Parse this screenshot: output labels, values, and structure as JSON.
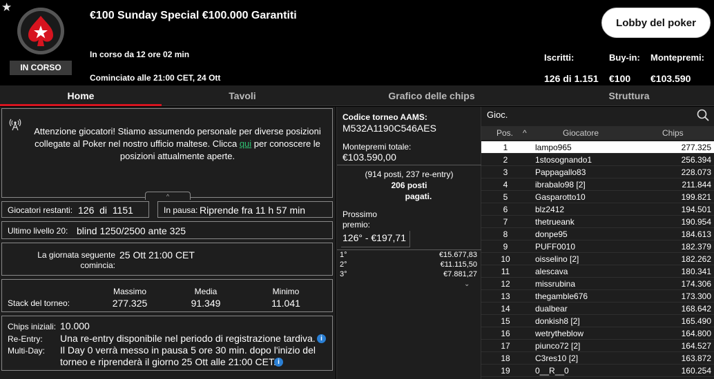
{
  "header": {
    "favorite_icon": "star-icon",
    "status": "IN CORSO",
    "title": "€100 Sunday Special €100.000 Garantiti",
    "running": "In corso da 12 ore 02 min",
    "started": "Cominciato alle 21:00 CET, 24 Ott",
    "lobby_button": "Lobby del poker",
    "registered_label": "Iscritti:",
    "registered_value": "126 di 1.151",
    "buyin_label": "Buy-in:",
    "buyin_value": "€100",
    "prize_label": "Montepremi:",
    "prize_value": "€103.590",
    "brand_color": "#d7141f"
  },
  "tabs": [
    {
      "label": "Home"
    },
    {
      "label": "Tavoli"
    },
    {
      "label": "Grafico delle chips"
    },
    {
      "label": "Struttura"
    }
  ],
  "announcement": {
    "text_before": "Attenzione giocatori! Stiamo assumendo personale per diverse posizioni collegate al Poker nel nostro ufficio maltese. Clicca ",
    "link": "qui",
    "text_after": " per conoscere le posizioni attualmente aperte."
  },
  "info": {
    "remaining_label": "Giocatori restanti:",
    "remaining_value": "126  di  1151",
    "pause_label": "In pausa:",
    "pause_value": "Riprende fra 11 h 57 min",
    "last_level_label": "Ultimo livello 20:",
    "last_level_value": "blind 1250/2500 ante 325",
    "next_day_label_1": "La giornata seguente",
    "next_day_label_2": "comincia:",
    "next_day_value": "25 Ott 21:00 CET",
    "stack_label": "Stack del torneo:",
    "stack_max_label": "Massimo",
    "stack_max_value": "277.325",
    "stack_avg_label": "Media",
    "stack_avg_value": "91.349",
    "stack_min_label": "Minimo",
    "stack_min_value": "11.041",
    "initial_chips_label": "Chips iniziali:",
    "initial_chips_value": "10.000",
    "reentry_label": "Re-Entry:",
    "reentry_value": "Una re-entry disponibile nel periodo di registrazione tardiva.",
    "multiday_label": "Multi-Day:",
    "multiday_value_1": "Il Day 0 verrà messo in pausa 5 ore 30 min. dopo l'inizio del",
    "multiday_value_2": "torneo e riprenderà il giorno 25 Ott alle 21:00 CET."
  },
  "prize": {
    "code_label": "Codice torneo AAMS:",
    "code_value": "M532A1190C546AES",
    "total_label": "Montepremi totale:",
    "total_value": "€103.590,00",
    "places_line": "(914 posti, 237 re-entry)",
    "paid_line_1": "206 posti",
    "paid_line_2": "pagati.",
    "next_label_1": "Prossimo",
    "next_label_2": "premio:",
    "next_value": "126° - €197,71",
    "places": [
      {
        "pos": "1°",
        "amount": "€15.677,83"
      },
      {
        "pos": "2°",
        "amount": "€11.115,50"
      },
      {
        "pos": "3°",
        "amount": "€7.881,27"
      }
    ]
  },
  "players": {
    "search_label": "Gioc.",
    "col_pos": "Pos.",
    "col_player": "Giocatore",
    "col_chips": "Chips",
    "rows": [
      {
        "pos": "1",
        "name": "lampo965",
        "chips": "277.325"
      },
      {
        "pos": "2",
        "name": "1stosognando1",
        "chips": "256.394"
      },
      {
        "pos": "3",
        "name": "Pappagallo83",
        "chips": "228.073"
      },
      {
        "pos": "4",
        "name": "ibrabalo98 [2]",
        "chips": "211.844"
      },
      {
        "pos": "5",
        "name": "Gasparotto10",
        "chips": "199.821"
      },
      {
        "pos": "6",
        "name": "blz2412",
        "chips": "194.501"
      },
      {
        "pos": "7",
        "name": "thetrueank",
        "chips": "190.954"
      },
      {
        "pos": "8",
        "name": "donpe95",
        "chips": "184.613"
      },
      {
        "pos": "9",
        "name": "PUFF0010",
        "chips": "182.379"
      },
      {
        "pos": "10",
        "name": "oisselino [2]",
        "chips": "182.262"
      },
      {
        "pos": "11",
        "name": "alescava",
        "chips": "180.341"
      },
      {
        "pos": "12",
        "name": "missrubina",
        "chips": "174.306"
      },
      {
        "pos": "13",
        "name": "thegamble676",
        "chips": "173.300"
      },
      {
        "pos": "14",
        "name": "dualbear",
        "chips": "168.642"
      },
      {
        "pos": "15",
        "name": "donkish8 [2]",
        "chips": "165.490"
      },
      {
        "pos": "16",
        "name": "wetrytheblow",
        "chips": "164.800"
      },
      {
        "pos": "17",
        "name": "piunco72 [2]",
        "chips": "164.527"
      },
      {
        "pos": "18",
        "name": "C3res10 [2]",
        "chips": "163.872"
      },
      {
        "pos": "19",
        "name": "0__R__0",
        "chips": "160.254"
      }
    ]
  }
}
